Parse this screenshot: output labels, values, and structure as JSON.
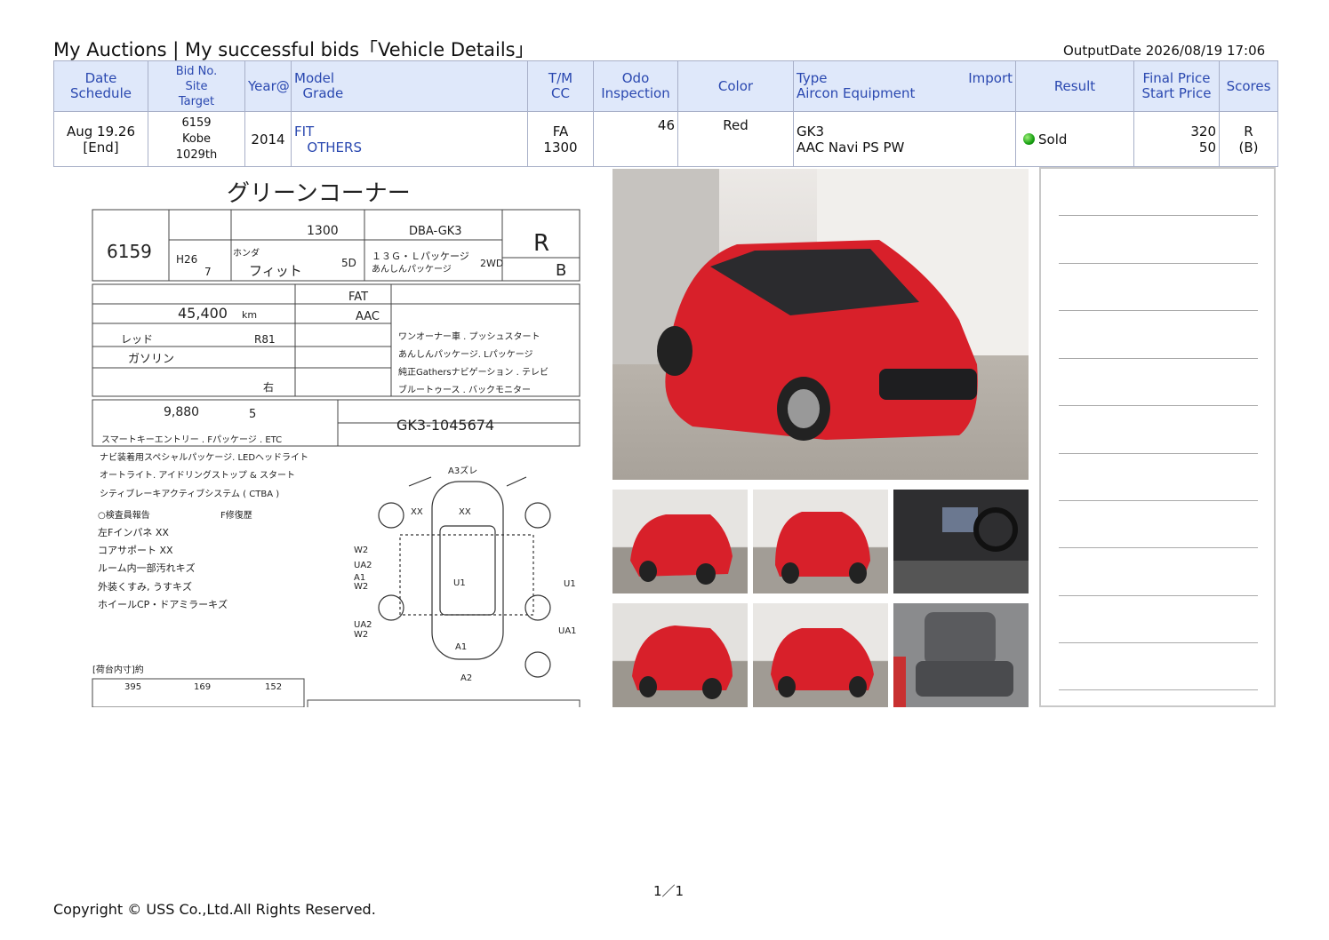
{
  "page": {
    "title": "My Auctions | My successful bids「Vehicle Details」",
    "output_date": "OutputDate  2026/08/19 17:06",
    "pager": "1／1",
    "copyright": "Copyright © USS Co.,Ltd.All Rights Reserved."
  },
  "table": {
    "headers": {
      "date": "Date",
      "schedule": "Schedule",
      "bidno": "Bid No.",
      "site": "Site",
      "target": "Target",
      "year": "Year@",
      "model": "Model",
      "grade": "Grade",
      "tm": "T/M",
      "cc": "CC",
      "odo": "Odo",
      "inspection": "Inspection",
      "color": "Color",
      "type": "Type",
      "import": "Import",
      "aircon": "Aircon Equipment",
      "result": "Result",
      "final_price": "Final Price",
      "start_price": "Start Price",
      "scores": "Scores"
    },
    "row": {
      "date": "Aug 19.26",
      "schedule": "[End]",
      "bidno": "6159",
      "site": "Kobe",
      "target": "1029th",
      "year": "2014",
      "model": "FIT",
      "grade": "OTHERS",
      "tm": "FA",
      "cc": "1300",
      "odo": "46",
      "color": "Red",
      "type": "GK3",
      "equipment": "AAC Navi PS PW",
      "result": "Sold",
      "final_price": "320",
      "start_price": "50",
      "score": "R",
      "interior": "(B)"
    }
  },
  "sheet": {
    "header": "グリーンコーナー",
    "lot": "6159",
    "displacement": "1300",
    "model_code": "DBA-GK3",
    "score": "R",
    "interior_score": "B",
    "reg_year": "H26",
    "reg_month": "7",
    "maker": "ホンダ",
    "car_name": "フィット",
    "doors": "5D",
    "grade": "１３Ｇ・Ｌパッケージ",
    "grade2": "あんしんパッケージ",
    "drive": "2WD",
    "shift": "FAT",
    "aircon": "AAC",
    "mileage": "45,400",
    "mileage_unit": "km",
    "color": "レッド",
    "color_code": "R81",
    "fuel": "ガソリン",
    "handle": "右",
    "recycle": "9,880",
    "capacity": "5",
    "chassis": "GK3-1045674",
    "sales_points": [
      "ワンオーナー車 . プッシュスタート",
      "あんしんパッケージ. Lパッケージ",
      "純正Gathersナビゲーション . テレビ",
      "ブルートゥース . バックモニター"
    ],
    "notes": [
      "スマートキーエントリー . Fパッケージ . ETC",
      "ナビ装着用スペシャルパッケージ. LEDヘッドライト",
      "オートライト. アイドリングストップ & スタート",
      "シティブレーキアクティブシステム ( CTBA )"
    ],
    "inspector_title": "○検査員報告",
    "inspector_sub": "F修復歴",
    "inspector": [
      "左Fインパネ XX",
      "コアサポート XX",
      "ルーム内一部汚れキズ",
      "外装くすみ, うすキズ",
      "ホイールCP・ドアミラーキズ"
    ],
    "dims_title": "[荷台内寸]約",
    "length": "395",
    "width": "169",
    "height": "152",
    "marks": [
      "A3ズレ",
      "XX",
      "XX",
      "W2",
      "UA2",
      "A1",
      "W2",
      "U1",
      "U1",
      "UA2",
      "W2",
      "UA1",
      "A1",
      "A2"
    ]
  },
  "colors": {
    "car_red": "#d8202a",
    "header_blue": "#2a48b0",
    "header_bg": "#dfe8fa"
  }
}
